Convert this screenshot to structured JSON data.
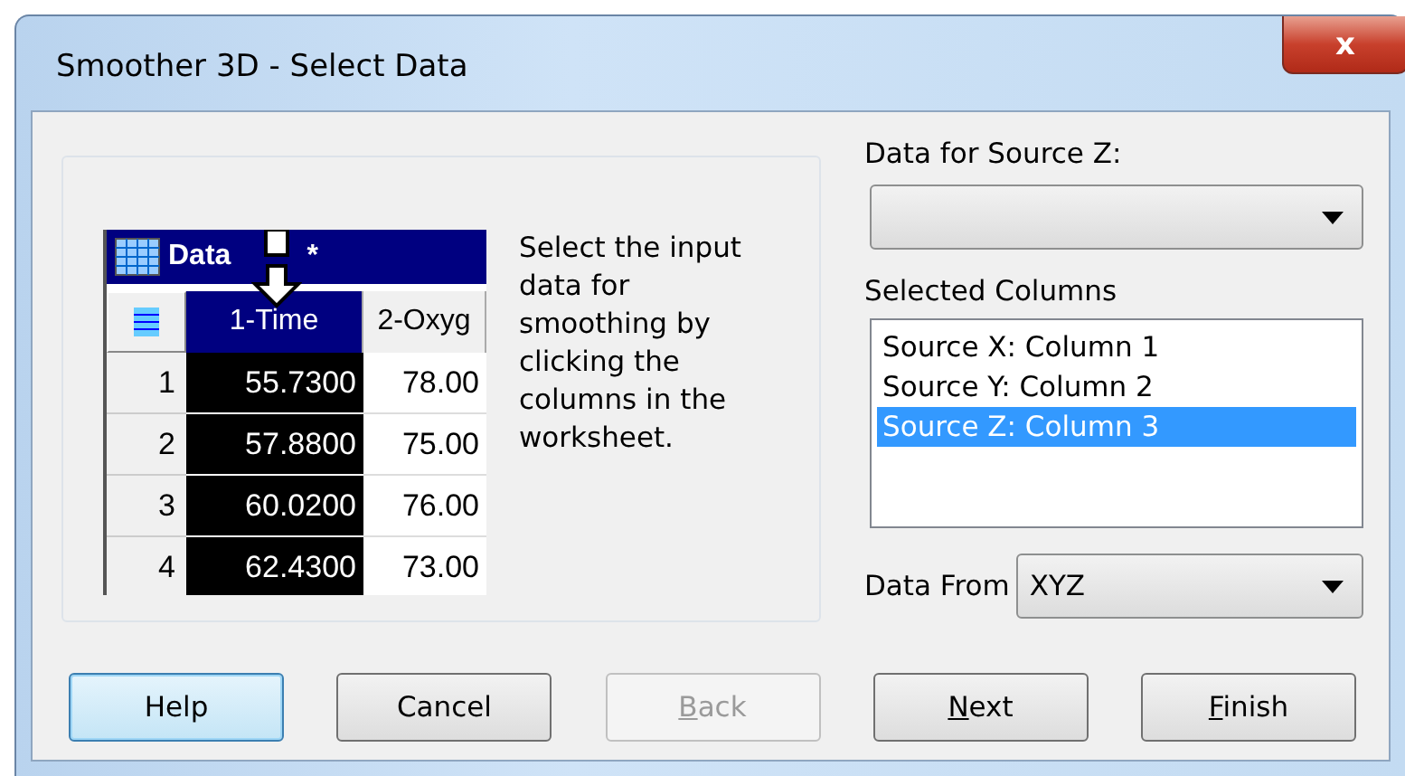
{
  "window": {
    "title": "Smoother 3D - Select Data",
    "close": "x"
  },
  "worksheet": {
    "title": "Data",
    "title_suffix": "*",
    "columns": [
      {
        "label": "1-Time",
        "selected": true
      },
      {
        "label": "2-Oxyg",
        "selected": false
      }
    ],
    "rows": [
      {
        "index": "1",
        "cells": [
          "55.7300",
          "78.00"
        ]
      },
      {
        "index": "2",
        "cells": [
          "57.8800",
          "75.00"
        ]
      },
      {
        "index": "3",
        "cells": [
          "60.0200",
          "76.00"
        ]
      },
      {
        "index": "4",
        "cells": [
          "62.4300",
          "73.00"
        ]
      }
    ]
  },
  "instructions": "Select the input data for smoothing by clicking the columns in the worksheet.",
  "source_z": {
    "label": "Data for Source Z:"
  },
  "selected_columns": {
    "label": "Selected Columns",
    "items": [
      {
        "label": "Source X: Column 1",
        "selected": false
      },
      {
        "label": "Source Y: Column 2",
        "selected": false
      },
      {
        "label": "Source Z: Column 3",
        "selected": true
      }
    ]
  },
  "data_from": {
    "label": "Data From",
    "value": "XYZ"
  },
  "buttons": [
    {
      "label": "Help",
      "focused": true,
      "disabled": false,
      "mnemonic": false
    },
    {
      "label": "Cancel",
      "focused": false,
      "disabled": false,
      "mnemonic": false
    },
    {
      "label": "Back",
      "focused": false,
      "disabled": true,
      "mnemonic": true
    },
    {
      "label": "Next",
      "focused": false,
      "disabled": false,
      "mnemonic": true
    },
    {
      "label": "Finish",
      "focused": false,
      "disabled": false,
      "mnemonic": true
    }
  ]
}
